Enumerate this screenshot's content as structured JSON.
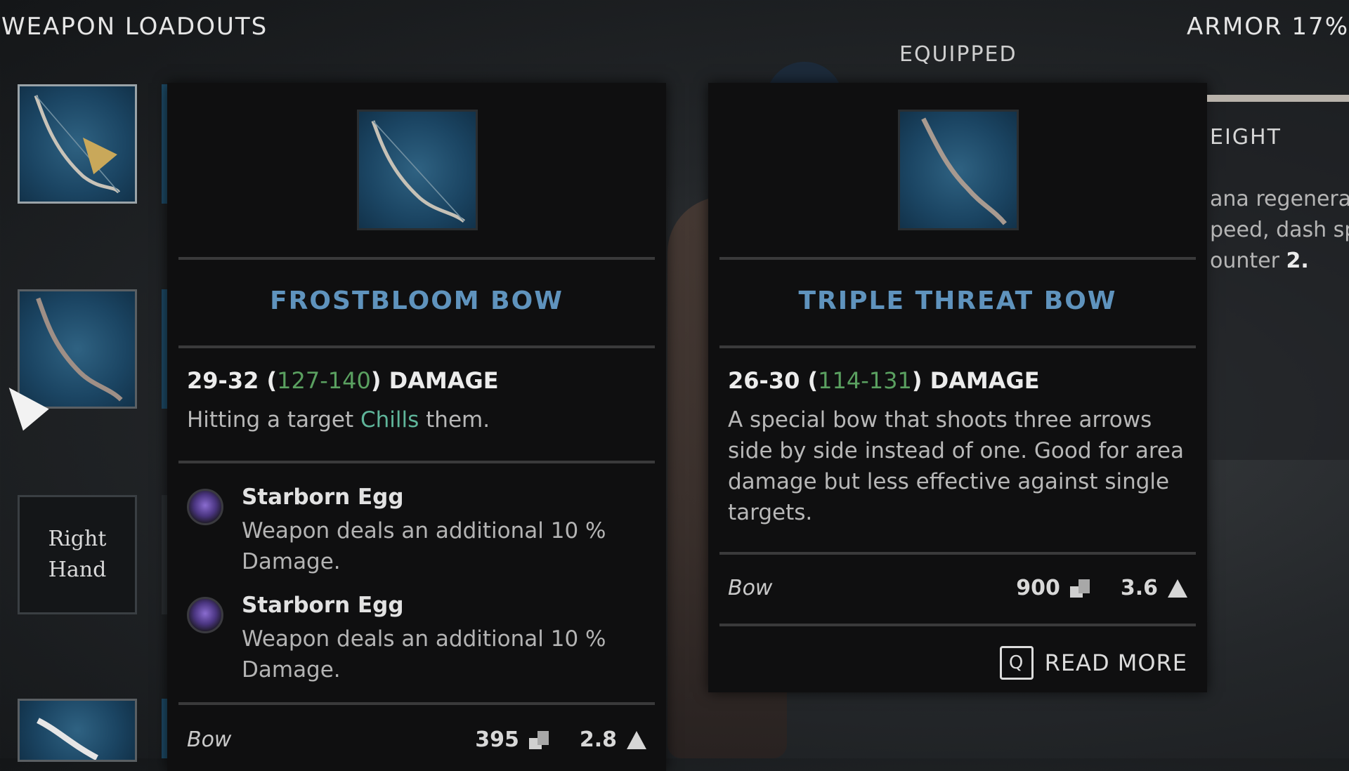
{
  "header": {
    "title": "WEAPON LOADOUTS",
    "armor": "ARMOR 17%",
    "equipped_label": "EQUIPPED"
  },
  "slots": [
    {
      "kind": "bow",
      "selected": true
    },
    {
      "kind": "bow",
      "selected": false
    },
    {
      "kind": "label",
      "label_line1": "Right",
      "label_line2": "Hand"
    },
    {
      "kind": "bow",
      "selected": false
    }
  ],
  "card_hovered": {
    "name": "FROSTBLOOM BOW",
    "damage_base": "29-32",
    "damage_min": "127",
    "damage_max": "140",
    "damage_suffix": "DAMAGE",
    "desc_pre": "Hitting a target ",
    "desc_highlight": "Chills",
    "desc_post": " them.",
    "perks": [
      {
        "name": "Starborn Egg",
        "text": "Weapon deals an additional 10 % Damage."
      },
      {
        "name": "Starborn Egg",
        "text": "Weapon deals an additional 10 % Damage."
      }
    ],
    "type": "Bow",
    "value": "395",
    "weight": "2.8"
  },
  "card_equipped": {
    "name": "TRIPLE THREAT BOW",
    "damage_base": "26-30",
    "damage_min": "114",
    "damage_max": "131",
    "damage_suffix": "DAMAGE",
    "desc": "A special bow that shoots three arrows side by side instead of one. Good for area damage but less effective against single targets.",
    "type": "Bow",
    "value": "900",
    "weight": "3.6",
    "read_more_key": "Q",
    "read_more_label": "READ MORE"
  },
  "right_panel": {
    "heading": "EIGHT",
    "line1": "ana regenera",
    "line2": "peed, dash sp",
    "line3_pre": "ounter ",
    "line3_bold": "2."
  },
  "colors": {
    "title_blue": "#5f93bd",
    "stat_green": "#5aa060",
    "keyword_teal": "#5fb59a",
    "perk_purple": "#8a6cd0"
  }
}
